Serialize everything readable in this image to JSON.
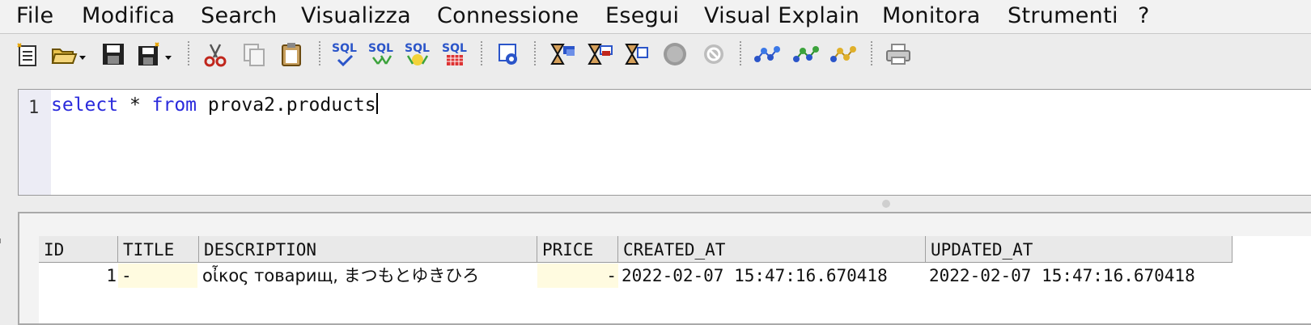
{
  "menu": [
    "File",
    "Modifica",
    "Search",
    "Visualizza",
    "Connessione",
    "Esegui",
    "Visual Explain",
    "Monitora",
    "Strumenti",
    "?"
  ],
  "toolbar": {
    "sql_label": "SQL",
    "buttons": [
      "new-script-icon",
      "open-folder-icon",
      "save-icon",
      "save-as-icon",
      "cut-icon",
      "copy-icon",
      "paste-icon",
      "sql-check-icon",
      "sql-execute-icon",
      "sql-execute-all-icon",
      "sql-grid-icon",
      "connection-icon",
      "explain-plan-icon",
      "explain-plan-2-icon",
      "explain-plan-3-icon",
      "stop-icon",
      "cancel-icon",
      "monitor-1-icon",
      "monitor-2-icon",
      "monitor-3-icon",
      "print-icon"
    ]
  },
  "editor": {
    "line_number": "1",
    "tokens": [
      {
        "text": "select",
        "kind": "keyword"
      },
      {
        "text": " * ",
        "kind": "plain"
      },
      {
        "text": "from",
        "kind": "keyword"
      },
      {
        "text": " prova2.products",
        "kind": "plain"
      }
    ]
  },
  "results": {
    "columns": [
      "ID",
      "TITLE",
      "DESCRIPTION",
      "PRICE",
      "CREATED_AT",
      "UPDATED_AT"
    ],
    "rows": [
      {
        "id": "1",
        "title": "-",
        "description": "οἶκος товарищ, まつもとゆきひろ",
        "price": "-",
        "created_at": "2022-02-07 15:47:16.670418",
        "updated_at": "2022-02-07 15:47:16.670418"
      }
    ]
  },
  "colors": {
    "keyword": "#2a2adc",
    "null_cell": "#fffbe0",
    "sql_icon": "#2b55c9"
  }
}
